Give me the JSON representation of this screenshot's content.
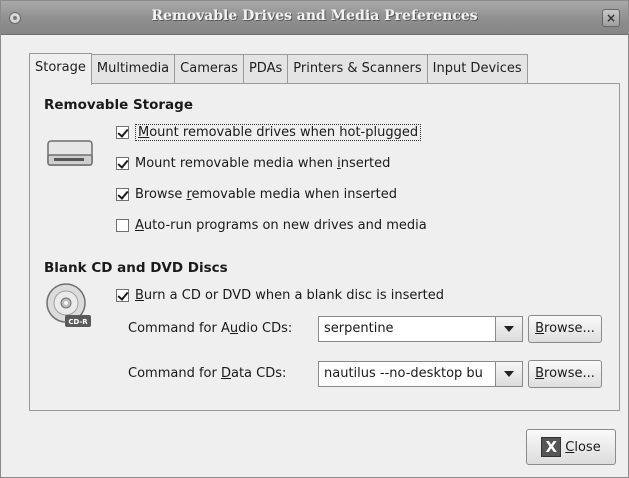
{
  "window": {
    "title": "Removable Drives and Media Preferences",
    "close_glyph": "×"
  },
  "tabs": [
    {
      "label": "Storage",
      "active": true
    },
    {
      "label": "Multimedia",
      "active": false
    },
    {
      "label": "Cameras",
      "active": false
    },
    {
      "label": "PDAs",
      "active": false
    },
    {
      "label": "Printers & Scanners",
      "active": false
    },
    {
      "label": "Input Devices",
      "active": false
    }
  ],
  "removable_storage": {
    "title": "Removable Storage",
    "options": [
      {
        "mnemonic": "M",
        "rest": "ount removable drives when hot-plugged",
        "checked": true
      },
      {
        "pre": "Mount removable media when ",
        "mnemonic": "i",
        "rest": "nserted",
        "checked": true
      },
      {
        "pre": "Browse ",
        "mnemonic": "r",
        "rest": "emovable media when inserted",
        "checked": true
      },
      {
        "mnemonic": "A",
        "rest": "uto-run programs on new drives and media",
        "checked": false
      }
    ]
  },
  "blank_discs": {
    "title": "Blank CD and DVD Discs",
    "icon_badge": "CD-R",
    "burn_option": {
      "mnemonic": "B",
      "rest": "urn a CD or DVD when a blank disc is inserted",
      "checked": true
    },
    "audio": {
      "label_pre": "Command for A",
      "label_mnemonic": "u",
      "label_rest": "dio CDs:",
      "value": "serpentine"
    },
    "data": {
      "label_pre": "Command for ",
      "label_mnemonic": "D",
      "label_rest": "ata CDs:",
      "value": "nautilus --no-desktop bu"
    },
    "browse_mnemonic": "B",
    "browse_rest": "rowse..."
  },
  "footer": {
    "close_mnemonic": "C",
    "close_rest": "lose",
    "close_icon_glyph": "X"
  },
  "colors": {
    "titlebar": "#8f8f8f",
    "window_bg": "#efefef"
  }
}
